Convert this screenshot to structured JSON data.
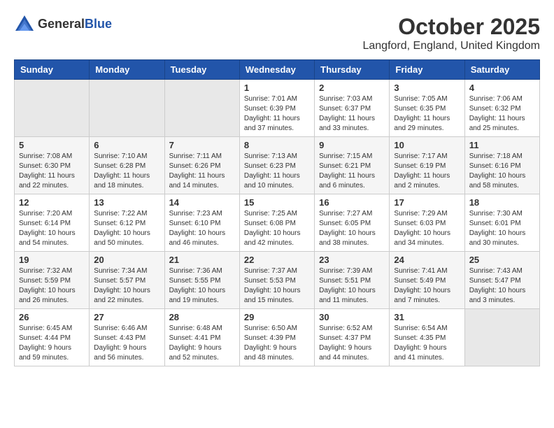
{
  "header": {
    "logo_general": "General",
    "logo_blue": "Blue",
    "month": "October 2025",
    "location": "Langford, England, United Kingdom"
  },
  "weekdays": [
    "Sunday",
    "Monday",
    "Tuesday",
    "Wednesday",
    "Thursday",
    "Friday",
    "Saturday"
  ],
  "weeks": [
    [
      {
        "day": "",
        "empty": true
      },
      {
        "day": "",
        "empty": true
      },
      {
        "day": "",
        "empty": true
      },
      {
        "day": "1",
        "sunrise": "Sunrise: 7:01 AM",
        "sunset": "Sunset: 6:39 PM",
        "daylight": "Daylight: 11 hours and 37 minutes."
      },
      {
        "day": "2",
        "sunrise": "Sunrise: 7:03 AM",
        "sunset": "Sunset: 6:37 PM",
        "daylight": "Daylight: 11 hours and 33 minutes."
      },
      {
        "day": "3",
        "sunrise": "Sunrise: 7:05 AM",
        "sunset": "Sunset: 6:35 PM",
        "daylight": "Daylight: 11 hours and 29 minutes."
      },
      {
        "day": "4",
        "sunrise": "Sunrise: 7:06 AM",
        "sunset": "Sunset: 6:32 PM",
        "daylight": "Daylight: 11 hours and 25 minutes."
      }
    ],
    [
      {
        "day": "5",
        "sunrise": "Sunrise: 7:08 AM",
        "sunset": "Sunset: 6:30 PM",
        "daylight": "Daylight: 11 hours and 22 minutes."
      },
      {
        "day": "6",
        "sunrise": "Sunrise: 7:10 AM",
        "sunset": "Sunset: 6:28 PM",
        "daylight": "Daylight: 11 hours and 18 minutes."
      },
      {
        "day": "7",
        "sunrise": "Sunrise: 7:11 AM",
        "sunset": "Sunset: 6:26 PM",
        "daylight": "Daylight: 11 hours and 14 minutes."
      },
      {
        "day": "8",
        "sunrise": "Sunrise: 7:13 AM",
        "sunset": "Sunset: 6:23 PM",
        "daylight": "Daylight: 11 hours and 10 minutes."
      },
      {
        "day": "9",
        "sunrise": "Sunrise: 7:15 AM",
        "sunset": "Sunset: 6:21 PM",
        "daylight": "Daylight: 11 hours and 6 minutes."
      },
      {
        "day": "10",
        "sunrise": "Sunrise: 7:17 AM",
        "sunset": "Sunset: 6:19 PM",
        "daylight": "Daylight: 11 hours and 2 minutes."
      },
      {
        "day": "11",
        "sunrise": "Sunrise: 7:18 AM",
        "sunset": "Sunset: 6:16 PM",
        "daylight": "Daylight: 10 hours and 58 minutes."
      }
    ],
    [
      {
        "day": "12",
        "sunrise": "Sunrise: 7:20 AM",
        "sunset": "Sunset: 6:14 PM",
        "daylight": "Daylight: 10 hours and 54 minutes."
      },
      {
        "day": "13",
        "sunrise": "Sunrise: 7:22 AM",
        "sunset": "Sunset: 6:12 PM",
        "daylight": "Daylight: 10 hours and 50 minutes."
      },
      {
        "day": "14",
        "sunrise": "Sunrise: 7:23 AM",
        "sunset": "Sunset: 6:10 PM",
        "daylight": "Daylight: 10 hours and 46 minutes."
      },
      {
        "day": "15",
        "sunrise": "Sunrise: 7:25 AM",
        "sunset": "Sunset: 6:08 PM",
        "daylight": "Daylight: 10 hours and 42 minutes."
      },
      {
        "day": "16",
        "sunrise": "Sunrise: 7:27 AM",
        "sunset": "Sunset: 6:05 PM",
        "daylight": "Daylight: 10 hours and 38 minutes."
      },
      {
        "day": "17",
        "sunrise": "Sunrise: 7:29 AM",
        "sunset": "Sunset: 6:03 PM",
        "daylight": "Daylight: 10 hours and 34 minutes."
      },
      {
        "day": "18",
        "sunrise": "Sunrise: 7:30 AM",
        "sunset": "Sunset: 6:01 PM",
        "daylight": "Daylight: 10 hours and 30 minutes."
      }
    ],
    [
      {
        "day": "19",
        "sunrise": "Sunrise: 7:32 AM",
        "sunset": "Sunset: 5:59 PM",
        "daylight": "Daylight: 10 hours and 26 minutes."
      },
      {
        "day": "20",
        "sunrise": "Sunrise: 7:34 AM",
        "sunset": "Sunset: 5:57 PM",
        "daylight": "Daylight: 10 hours and 22 minutes."
      },
      {
        "day": "21",
        "sunrise": "Sunrise: 7:36 AM",
        "sunset": "Sunset: 5:55 PM",
        "daylight": "Daylight: 10 hours and 19 minutes."
      },
      {
        "day": "22",
        "sunrise": "Sunrise: 7:37 AM",
        "sunset": "Sunset: 5:53 PM",
        "daylight": "Daylight: 10 hours and 15 minutes."
      },
      {
        "day": "23",
        "sunrise": "Sunrise: 7:39 AM",
        "sunset": "Sunset: 5:51 PM",
        "daylight": "Daylight: 10 hours and 11 minutes."
      },
      {
        "day": "24",
        "sunrise": "Sunrise: 7:41 AM",
        "sunset": "Sunset: 5:49 PM",
        "daylight": "Daylight: 10 hours and 7 minutes."
      },
      {
        "day": "25",
        "sunrise": "Sunrise: 7:43 AM",
        "sunset": "Sunset: 5:47 PM",
        "daylight": "Daylight: 10 hours and 3 minutes."
      }
    ],
    [
      {
        "day": "26",
        "sunrise": "Sunrise: 6:45 AM",
        "sunset": "Sunset: 4:44 PM",
        "daylight": "Daylight: 9 hours and 59 minutes."
      },
      {
        "day": "27",
        "sunrise": "Sunrise: 6:46 AM",
        "sunset": "Sunset: 4:43 PM",
        "daylight": "Daylight: 9 hours and 56 minutes."
      },
      {
        "day": "28",
        "sunrise": "Sunrise: 6:48 AM",
        "sunset": "Sunset: 4:41 PM",
        "daylight": "Daylight: 9 hours and 52 minutes."
      },
      {
        "day": "29",
        "sunrise": "Sunrise: 6:50 AM",
        "sunset": "Sunset: 4:39 PM",
        "daylight": "Daylight: 9 hours and 48 minutes."
      },
      {
        "day": "30",
        "sunrise": "Sunrise: 6:52 AM",
        "sunset": "Sunset: 4:37 PM",
        "daylight": "Daylight: 9 hours and 44 minutes."
      },
      {
        "day": "31",
        "sunrise": "Sunrise: 6:54 AM",
        "sunset": "Sunset: 4:35 PM",
        "daylight": "Daylight: 9 hours and 41 minutes."
      },
      {
        "day": "",
        "empty": true
      }
    ]
  ]
}
